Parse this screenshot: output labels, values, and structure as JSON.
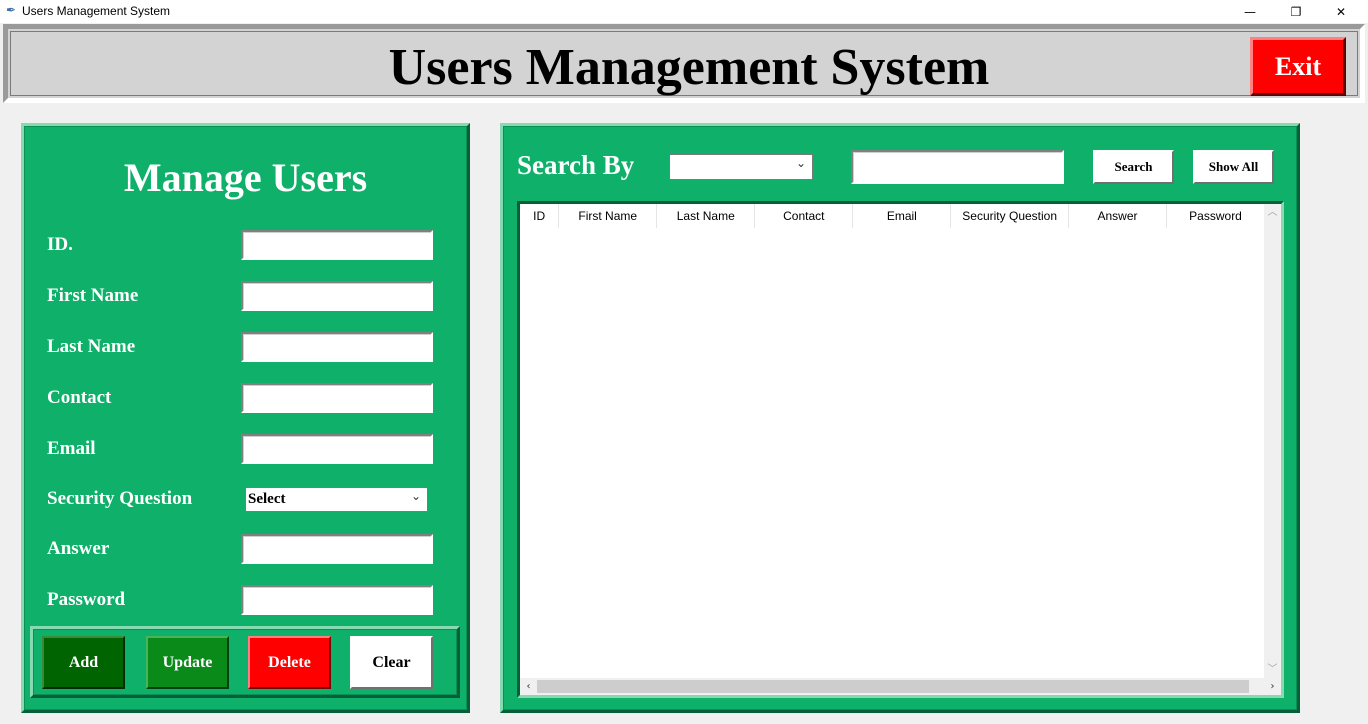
{
  "window": {
    "title": "Users Management System",
    "min_glyph": "—",
    "max_glyph": "❐",
    "close_glyph": "✕"
  },
  "header": {
    "title": "Users Management System",
    "exit_label": "Exit"
  },
  "manage": {
    "title": "Manage Users",
    "fields": [
      {
        "label": "ID.",
        "value": ""
      },
      {
        "label": "First Name",
        "value": ""
      },
      {
        "label": "Last Name",
        "value": ""
      },
      {
        "label": "Contact",
        "value": ""
      },
      {
        "label": "Email",
        "value": ""
      },
      {
        "label": "Security Question",
        "selected": "Select"
      },
      {
        "label": "Answer",
        "value": ""
      },
      {
        "label": "Password",
        "value": ""
      }
    ],
    "buttons": {
      "add": "Add",
      "update": "Update",
      "delete": "Delete",
      "clear": "Clear"
    }
  },
  "search": {
    "label": "Search By",
    "select_value": "",
    "input_value": "",
    "search_button": "Search",
    "show_all_button": "Show All"
  },
  "table": {
    "columns": [
      "ID",
      "First Name",
      "Last Name",
      "Contact",
      "Email",
      "Security Question",
      "Answer",
      "Password"
    ],
    "rows": []
  },
  "colors": {
    "panel_green": "#0eb06a",
    "exit_red": "#ff0000",
    "add_green": "#006400",
    "update_green": "#0a8a18",
    "delete_red": "#ff0000"
  }
}
